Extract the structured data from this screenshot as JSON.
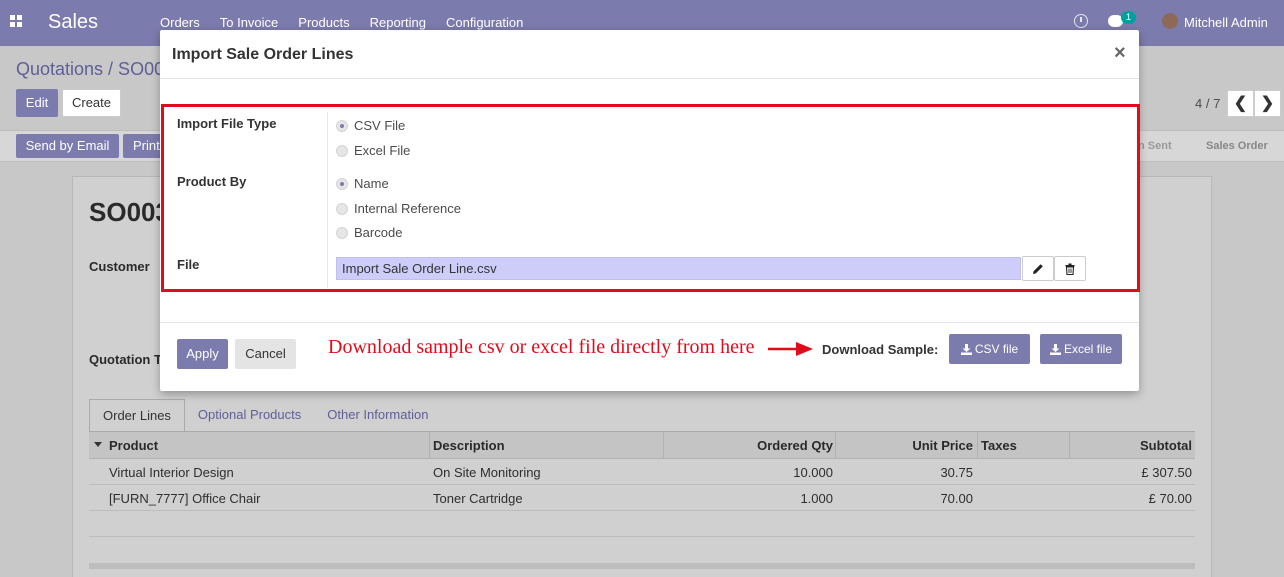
{
  "navbar": {
    "brand": "Sales",
    "menu": [
      "Orders",
      "To Invoice",
      "Products",
      "Reporting",
      "Configuration"
    ],
    "chat_badge": "1",
    "user_name": "Mitchell Admin"
  },
  "control_panel": {
    "breadcrumb": "Quotations / SO00",
    "edit_label": "Edit",
    "create_label": "Create",
    "pager": "4 / 7",
    "prev_symbol": "❮",
    "next_symbol": "❯"
  },
  "statusbar": {
    "send_email_label": "Send by Email",
    "print_label": "Print",
    "stage_sent": "n Sent",
    "stage_sales_order": "Sales Order"
  },
  "form": {
    "order_name": "SO003",
    "customer_label": "Customer",
    "quotation_template_label": "Quotation T"
  },
  "notebook": {
    "tabs": [
      "Order Lines",
      "Optional Products",
      "Other Information"
    ],
    "columns": [
      "Product",
      "Description",
      "Ordered Qty",
      "Unit Price",
      "Taxes",
      "Subtotal"
    ],
    "rows": [
      {
        "product": "Virtual Interior Design",
        "description": "On Site Monitoring",
        "qty": "10.000",
        "price": "30.75",
        "taxes": "",
        "subtotal": "£ 307.50"
      },
      {
        "product": "[FURN_7777] Office Chair",
        "description": "Toner Cartridge",
        "qty": "1.000",
        "price": "70.00",
        "taxes": "",
        "subtotal": "£ 70.00"
      }
    ]
  },
  "modal": {
    "title": "Import Sale Order Lines",
    "close_symbol": "×",
    "import_file_type_label": "Import File Type",
    "file_type_options": [
      {
        "label": "CSV File",
        "selected": true
      },
      {
        "label": "Excel File",
        "selected": false
      }
    ],
    "product_by_label": "Product By",
    "product_by_options": [
      {
        "label": "Name",
        "selected": true
      },
      {
        "label": "Internal Reference",
        "selected": false
      },
      {
        "label": "Barcode",
        "selected": false
      }
    ],
    "file_label": "File",
    "file_value": "Import Sale Order Line.csv",
    "apply_label": "Apply",
    "cancel_label": "Cancel",
    "annotation": "Download sample csv or excel file directly from here",
    "download_sample_label": "Download Sample:",
    "csv_button_label": "CSV file",
    "excel_button_label": "Excel file"
  },
  "colors": {
    "brand": "#7c7bad",
    "highlight": "#e00b1b",
    "file_input_bg": "#cecdfa"
  }
}
